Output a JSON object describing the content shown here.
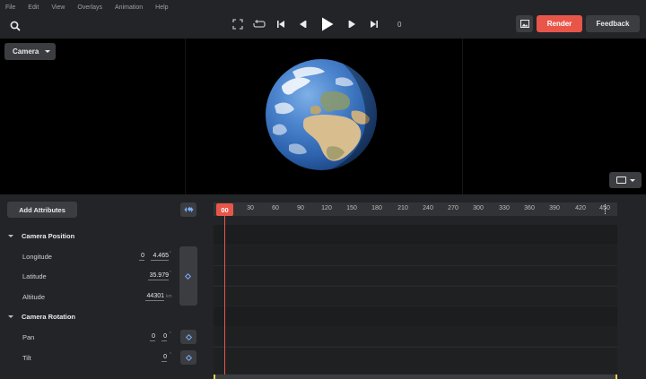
{
  "menu": [
    "File",
    "Edit",
    "View",
    "Overlays",
    "Animation",
    "Help"
  ],
  "toolbar": {
    "frame_counter": "0",
    "render_label": "Render",
    "feedback_label": "Feedback"
  },
  "viewport": {
    "camera_dropdown": "Camera"
  },
  "panel": {
    "add_attributes_label": "Add Attributes",
    "ruler_ticks": [
      "00",
      "30",
      "60",
      "90",
      "120",
      "150",
      "180",
      "210",
      "240",
      "270",
      "300",
      "330",
      "360",
      "390",
      "420",
      "450"
    ],
    "current_frame_label": "00",
    "groups": {
      "position": {
        "title": "Camera Position",
        "longitude": {
          "label": "Longitude",
          "deg": "0",
          "value": "4.465",
          "unit": "°"
        },
        "latitude": {
          "label": "Latitude",
          "value": "35.979",
          "unit": "°"
        },
        "altitude": {
          "label": "Altitude",
          "value": "44301",
          "unit": "km"
        }
      },
      "rotation": {
        "title": "Camera Rotation",
        "pan": {
          "label": "Pan",
          "deg": "0",
          "value": "0",
          "unit": "°"
        },
        "tilt": {
          "label": "Tilt",
          "value": "0",
          "unit": "°"
        }
      }
    }
  },
  "colors": {
    "accent_red": "#e8564a",
    "keyframe_blue": "#7ab0ff",
    "panel_bg": "#232427",
    "button_bg": "#3c3d40"
  }
}
